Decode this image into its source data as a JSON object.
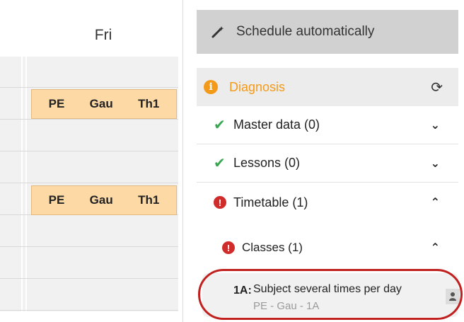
{
  "timetable": {
    "day": "Fri",
    "lessons": [
      {
        "subject": "PE",
        "teacher": "Gau",
        "room": "Th1"
      },
      {
        "subject": "PE",
        "teacher": "Gau",
        "room": "Th1"
      }
    ]
  },
  "panel": {
    "schedule_button": "Schedule automatically",
    "diagnosis": {
      "title": "Diagnosis"
    },
    "sections": [
      {
        "label": "Master data (0)",
        "status": "ok"
      },
      {
        "label": "Lessons (0)",
        "status": "ok"
      },
      {
        "label": "Timetable (1)",
        "status": "error"
      },
      {
        "label": "Classes (1)",
        "status": "error"
      }
    ],
    "issue": {
      "class": "1A:",
      "message": "Subject several times per day",
      "detail": "PE - Gau - 1A"
    }
  },
  "colors": {
    "accent": "#f39a1a",
    "error": "#d02c2c",
    "ok": "#3aa552",
    "lesson": "#fdd9a6"
  },
  "icons": [
    "magic-wand-icon",
    "info-icon",
    "refresh-icon",
    "check-icon",
    "error-icon",
    "chevron-down-icon",
    "chevron-up-icon",
    "teacher-icon"
  ]
}
